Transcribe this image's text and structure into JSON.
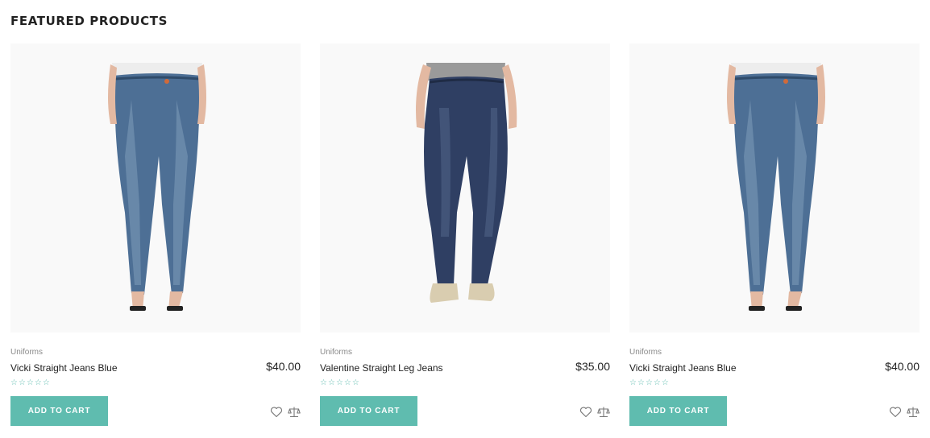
{
  "section": {
    "title": "FEATURED PRODUCTS"
  },
  "products": [
    {
      "category": "Uniforms",
      "name": "Vicki Straight Jeans Blue",
      "price": "$40.00",
      "stars_filled": 0,
      "stars_total": 5,
      "button": "ADD TO CART",
      "image": "jeans-light-blue-sandals"
    },
    {
      "category": "Uniforms",
      "name": "Valentine Straight Leg Jeans",
      "price": "$35.00",
      "stars_filled": 0,
      "stars_total": 5,
      "button": "ADD TO CART",
      "image": "jeans-dark-blue-brogues"
    },
    {
      "category": "Uniforms",
      "name": "Vicki Straight Jeans Blue",
      "price": "$40.00",
      "stars_filled": 0,
      "stars_total": 5,
      "button": "ADD TO CART",
      "image": "jeans-light-blue-sandals"
    }
  ],
  "colors": {
    "accent": "#5fbcaf",
    "image_bg": "#f9f9f9",
    "text": "#222222",
    "muted": "#8a8a8a"
  },
  "icons": {
    "star": "star-outline-icon",
    "wishlist": "heart-icon",
    "compare": "scale-icon"
  }
}
